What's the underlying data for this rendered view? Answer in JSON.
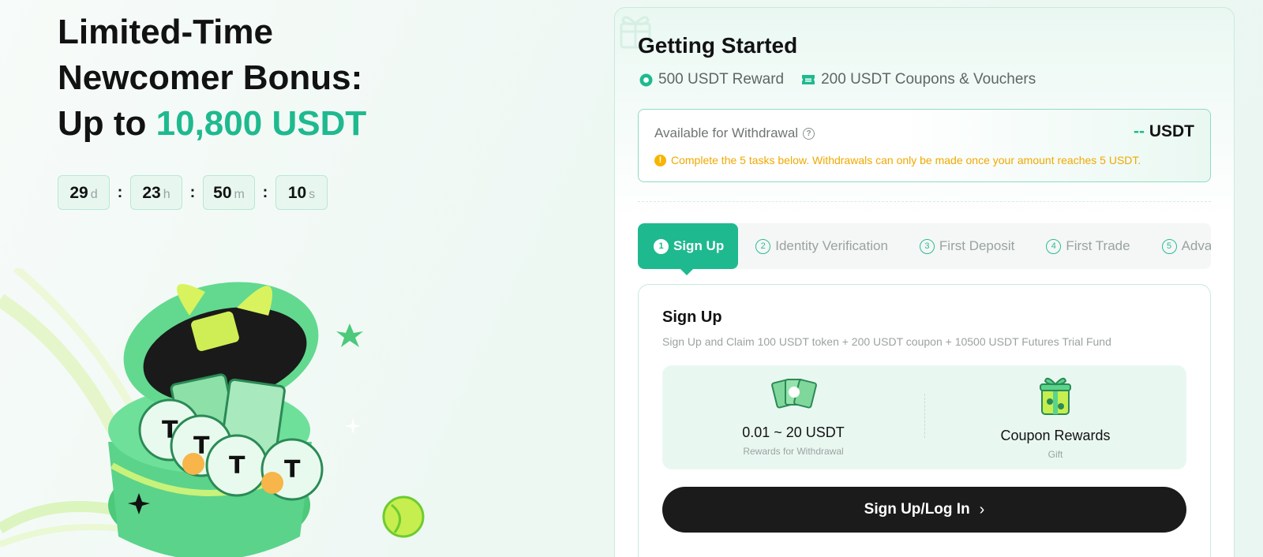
{
  "hero": {
    "title_line1": "Limited-Time",
    "title_line2": "Newcomer Bonus:",
    "title_line3_prefix": "Up to ",
    "title_line3_amount": "10,800 USDT"
  },
  "countdown": {
    "days": "29",
    "days_unit": "d",
    "hours": "23",
    "hours_unit": "h",
    "minutes": "50",
    "minutes_unit": "m",
    "seconds": "10",
    "seconds_unit": "s",
    "separator": ":"
  },
  "panel": {
    "title": "Getting Started",
    "perks": [
      {
        "label": "500 USDT Reward",
        "icon": "coin-icon"
      },
      {
        "label": "200 USDT Coupons & Vouchers",
        "icon": "ticket-icon"
      }
    ],
    "withdrawal": {
      "label": "Available for Withdrawal",
      "value_dash": "--",
      "value_unit": "USDT",
      "note": "Complete the 5 tasks below. Withdrawals can only be made once your amount reaches 5 USDT."
    },
    "steps": [
      {
        "num": "1",
        "label": "Sign Up"
      },
      {
        "num": "2",
        "label": "Identity Verification"
      },
      {
        "num": "3",
        "label": "First Deposit"
      },
      {
        "num": "4",
        "label": "First Trade"
      },
      {
        "num": "5",
        "label": "Advanced Verification"
      }
    ],
    "task": {
      "title": "Sign Up",
      "description": "Sign Up and Claim 100 USDT token + 200 USDT coupon + 10500 USDT Futures Trial Fund",
      "rewards": [
        {
          "main": "0.01 ~ 20 USDT",
          "sub": "Rewards for Withdrawal",
          "icon": "voucher-cards-icon"
        },
        {
          "main": "Coupon Rewards",
          "sub": "Gift",
          "icon": "gift-icon"
        }
      ],
      "cta_label": "Sign Up/Log In"
    }
  },
  "colors": {
    "accent": "#1fb98f",
    "warning": "#f0a900",
    "cta_bg": "#1b1b1b"
  }
}
